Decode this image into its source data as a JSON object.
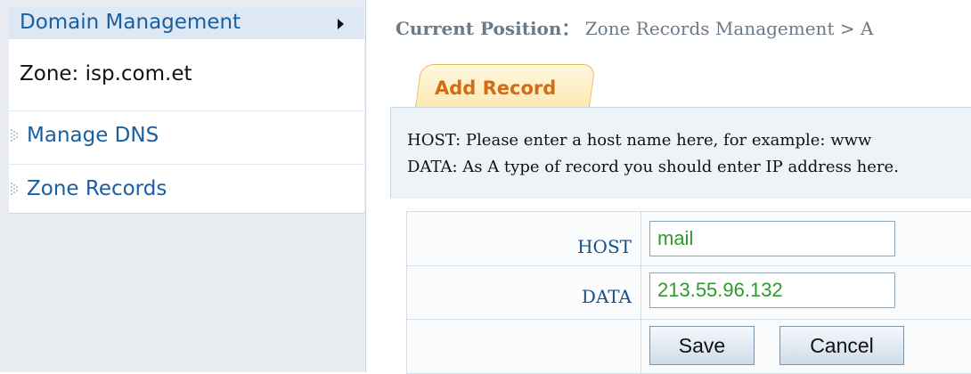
{
  "sidebar": {
    "header": "Domain Management",
    "zone": "Zone: isp.com.et",
    "items": [
      {
        "label": "Manage DNS"
      },
      {
        "label": "Zone Records"
      }
    ]
  },
  "breadcrumb": {
    "label": "Current Position：",
    "path": "Zone Records Management > A"
  },
  "tab": {
    "label": "Add Record"
  },
  "info": {
    "line1": "HOST: Please enter a host name here, for example: www",
    "line2": "DATA: As A type of record you should enter IP address here."
  },
  "form": {
    "host_label": "HOST",
    "host_value": "mail",
    "data_label": "DATA",
    "data_value": "213.55.96.132",
    "save_label": "Save",
    "cancel_label": "Cancel"
  },
  "colors": {
    "link_blue": "#1a5fa0",
    "tab_orange": "#d36c16",
    "input_green": "#2e9a2e"
  }
}
